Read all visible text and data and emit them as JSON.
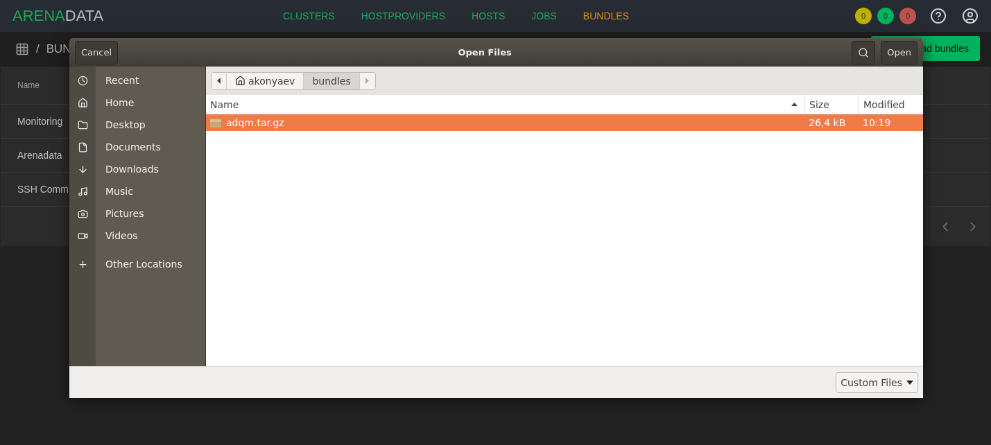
{
  "app": {
    "logo_primary": "ARENA",
    "logo_secondary": "DATA",
    "nav": [
      {
        "label": "CLUSTERS",
        "selected": false
      },
      {
        "label": "HOSTPROVIDERS",
        "selected": false
      },
      {
        "label": "HOSTS",
        "selected": false
      },
      {
        "label": "JOBS",
        "selected": false
      },
      {
        "label": "BUNDLES",
        "selected": true
      }
    ],
    "badges": [
      {
        "count": "0",
        "color": "#bdb000"
      },
      {
        "count": "0",
        "color": "#00b25c"
      },
      {
        "count": "0",
        "color": "#c0504d"
      }
    ],
    "breadcrumb": {
      "separator": "/",
      "current": "BUN"
    },
    "upload_button": "ad bundles",
    "table": {
      "column_1": "Name",
      "rows": [
        "Monitoring",
        "Arenadata",
        "SSH Comm"
      ]
    }
  },
  "dialog": {
    "title": "Open Files",
    "cancel": "Cancel",
    "open": "Open",
    "places": [
      {
        "label": "Recent",
        "kind": "place"
      },
      {
        "label": "Home",
        "kind": "place"
      },
      {
        "label": "Desktop",
        "kind": "place"
      },
      {
        "label": "Documents",
        "kind": "place"
      },
      {
        "label": "Downloads",
        "kind": "place"
      },
      {
        "label": "Music",
        "kind": "place"
      },
      {
        "label": "Pictures",
        "kind": "place"
      },
      {
        "label": "Videos",
        "kind": "place"
      },
      {
        "label": "Other Locations",
        "kind": "other"
      }
    ],
    "path": [
      {
        "label": "akonyaev",
        "selected": false,
        "home": true
      },
      {
        "label": "bundles",
        "selected": true,
        "home": false
      }
    ],
    "columns": [
      "Name",
      "Size",
      "Modified"
    ],
    "files": [
      {
        "name": "adqm.tar.gz",
        "size": "26,4 kB",
        "modified": "10:19",
        "selected": true
      }
    ],
    "filter": "Custom Files"
  }
}
